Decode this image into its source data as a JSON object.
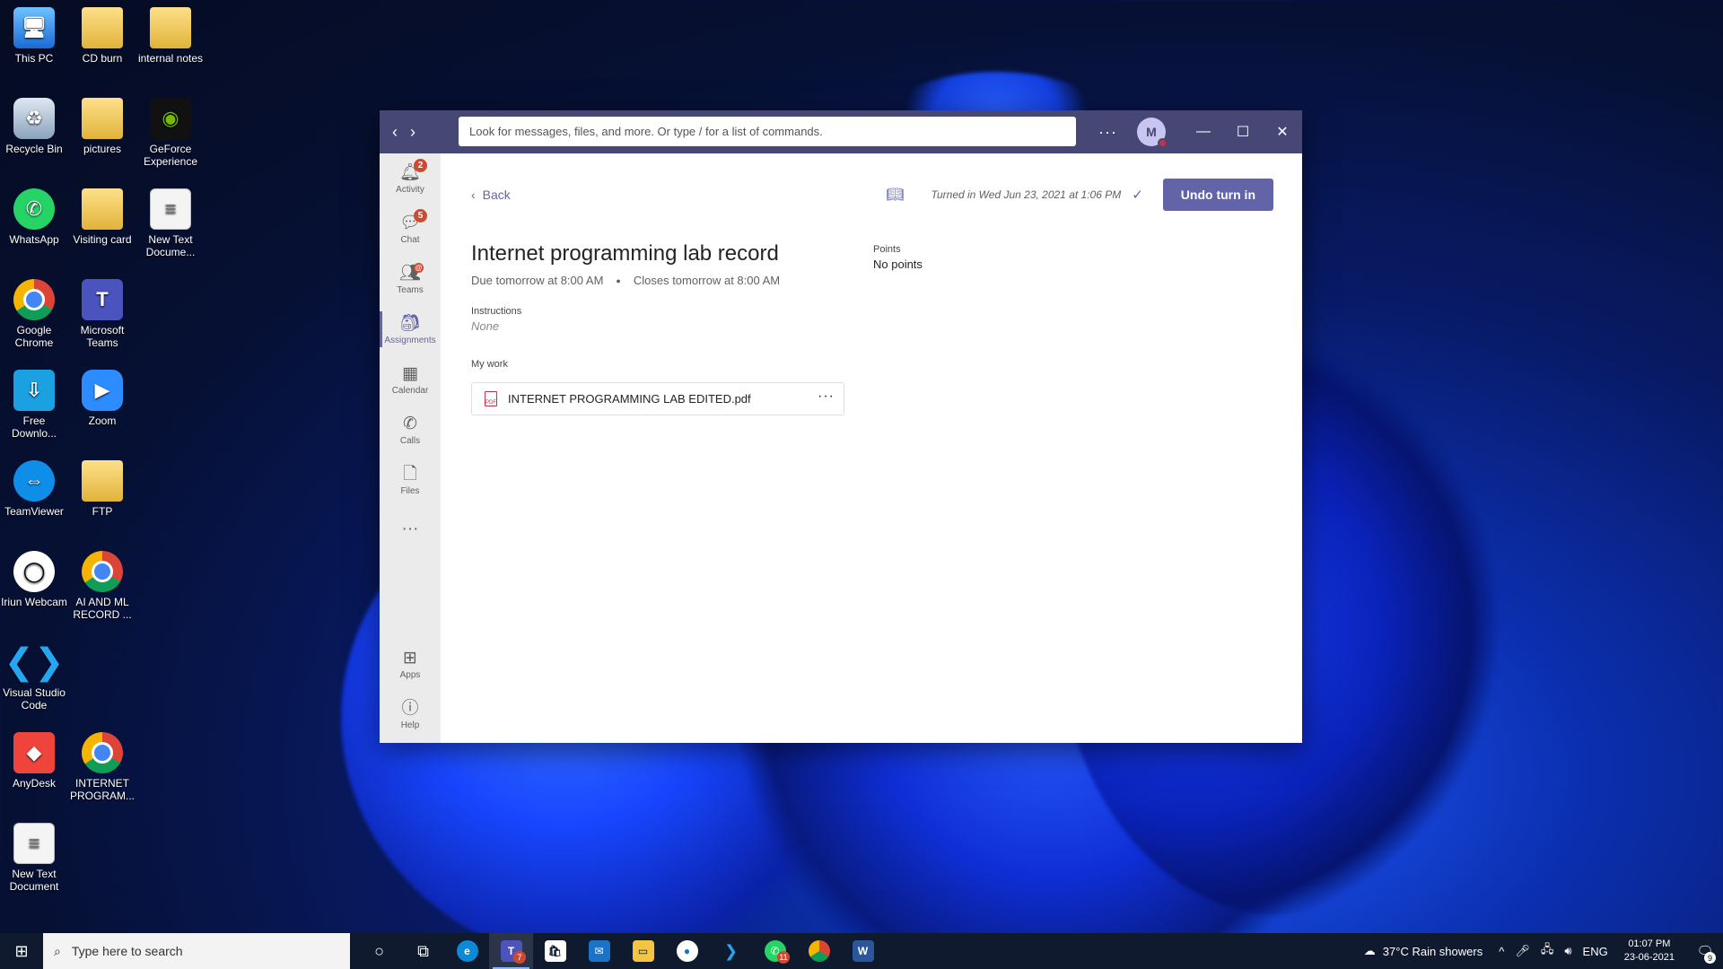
{
  "desktop": {
    "icons": [
      {
        "label": "This PC",
        "icon": "this-pc-icon",
        "glyph": "🖥"
      },
      {
        "label": "CD burn",
        "icon": "folder-icon",
        "glyph": ""
      },
      {
        "label": "internal notes",
        "icon": "folder-icon",
        "glyph": ""
      },
      {
        "label": "Recycle Bin",
        "icon": "recycle-bin-icon",
        "glyph": "♻"
      },
      {
        "label": "pictures",
        "icon": "folder-icon",
        "glyph": ""
      },
      {
        "label": "GeForce Experience",
        "icon": "nvidia-icon",
        "glyph": "◉"
      },
      {
        "label": "WhatsApp",
        "icon": "whatsapp-icon",
        "glyph": "✆"
      },
      {
        "label": "Visiting card",
        "icon": "folder-icon",
        "glyph": ""
      },
      {
        "label": "New Text Docume...",
        "icon": "text-document-icon",
        "glyph": "≡"
      },
      {
        "label": "Google Chrome",
        "icon": "chrome-icon",
        "glyph": ""
      },
      {
        "label": "Microsoft Teams",
        "icon": "teams-icon",
        "glyph": "T"
      },
      {
        "label": "Free Downlo...",
        "icon": "download-manager-icon",
        "glyph": "⇩"
      },
      {
        "label": "Zoom",
        "icon": "zoom-icon",
        "glyph": "▶"
      },
      {
        "label": "TeamViewer",
        "icon": "teamviewer-icon",
        "glyph": "⇔"
      },
      {
        "label": "FTP",
        "icon": "folder-icon",
        "glyph": ""
      },
      {
        "label": "Iriun Webcam",
        "icon": "webcam-icon",
        "glyph": "◯"
      },
      {
        "label": "AI AND ML RECORD ...",
        "icon": "chrome-icon",
        "glyph": ""
      },
      {
        "label": "Visual Studio Code",
        "icon": "vscode-icon",
        "glyph": "❮❯"
      },
      {
        "label": "AnyDesk",
        "icon": "anydesk-icon",
        "glyph": "◆"
      },
      {
        "label": "INTERNET PROGRAM...",
        "icon": "chrome-icon",
        "glyph": ""
      },
      {
        "label": "New Text Document",
        "icon": "text-document-icon",
        "glyph": "≡"
      }
    ]
  },
  "teams": {
    "search_placeholder": "Look for messages, files, and more. Or type / for a list of commands.",
    "more_label": "···",
    "avatar_initial": "M",
    "rail": {
      "activity": {
        "label": "Activity",
        "badge": "2"
      },
      "chat": {
        "label": "Chat",
        "badge": "5"
      },
      "teams": {
        "label": "Teams",
        "badge": "@"
      },
      "assignments": {
        "label": "Assignments"
      },
      "calendar": {
        "label": "Calendar"
      },
      "calls": {
        "label": "Calls"
      },
      "files": {
        "label": "Files"
      },
      "more": "···",
      "apps": {
        "label": "Apps"
      },
      "help": {
        "label": "Help"
      }
    },
    "assignment": {
      "back_label": "Back",
      "turned_in_text": "Turned in Wed Jun 23, 2021 at 1:06 PM",
      "undo_label": "Undo turn in",
      "title": "Internet programming lab record",
      "due": "Due tomorrow at 8:00 AM",
      "closes": "Closes tomorrow at 8:00 AM",
      "points_label": "Points",
      "points_value": "No points",
      "instructions_label": "Instructions",
      "instructions_value": "None",
      "my_work_label": "My work",
      "file_name": "INTERNET PROGRAMMING LAB EDITED.pdf",
      "file_type": "PDF",
      "file_more": "···"
    }
  },
  "taskbar": {
    "search_placeholder": "Type here to search",
    "teams_badge": "7",
    "whatsapp_badge": "11",
    "weather": "37°C  Rain showers",
    "language": "ENG",
    "time": "01:07 PM",
    "date": "23-06-2021",
    "notification_count": "9"
  }
}
